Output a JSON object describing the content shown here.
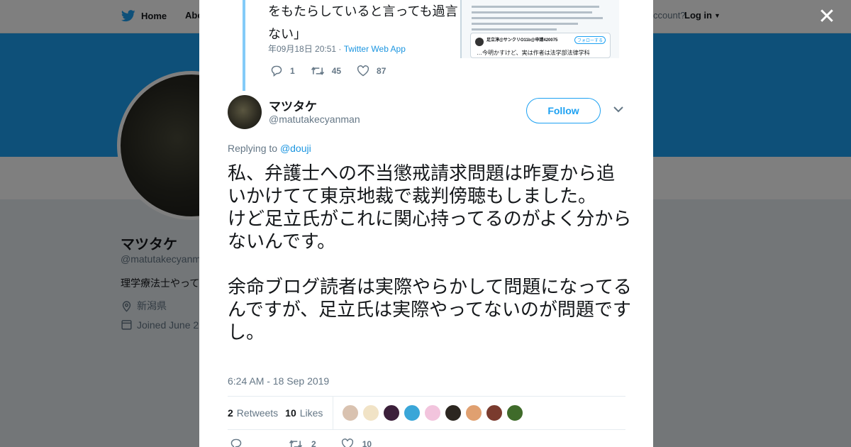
{
  "nav": {
    "home": "Home",
    "about": "Abo",
    "account_prompt": "ccount?",
    "login": "Log in"
  },
  "profile_bg": {
    "name": "マツタケ",
    "handle": "@matutakecyanm",
    "bio": "理学療法士やって",
    "location": "新潟県",
    "joined": "Joined June 2"
  },
  "quoted_tweet": {
    "text_line1": "をもたらしていると言っても過言",
    "text_line2": "ない」",
    "meta_date": "年09月18日 20:51 · ",
    "meta_app": "Twitter Web App",
    "reply_count": "1",
    "retweet_count": "45",
    "like_count": "87",
    "card_name": "足立淳@サンクリO11b@申請420075",
    "card_follow": "フォローする",
    "card_text": "…今明かすけど、実は作者は法学部法律学科"
  },
  "tweet": {
    "name": "マツタケ",
    "handle": "@matutakecyanman",
    "follow_label": "Follow",
    "replying_prefix": "Replying to ",
    "replying_to": "@douji",
    "text": "私、弁護士への不当懲戒請求問題は昨夏から追いかけてて東京地裁で裁判傍聴もしました。\nけど足立氏がこれに関心持ってるのがよく分からないんです。\n\n余命ブログ読者は実際やらかして問題になってるんですが、足立氏は実際やってないのが問題ですし。",
    "timestamp": "6:24 AM - 18 Sep 2019",
    "retweets_count": "2",
    "retweets_label": "Retweets",
    "likes_count": "10",
    "likes_label": "Likes",
    "bottom_retweets": "2",
    "bottom_likes": "10"
  },
  "likers": [
    {
      "name": "liker-1",
      "color": "#d9c2b0"
    },
    {
      "name": "liker-2",
      "color": "#f1e3c6"
    },
    {
      "name": "liker-3",
      "color": "#3b1f3a"
    },
    {
      "name": "liker-4",
      "color": "#3aa6d8"
    },
    {
      "name": "liker-5",
      "color": "#f2c4dd"
    },
    {
      "name": "liker-6",
      "color": "#2b2620"
    },
    {
      "name": "liker-7",
      "color": "#e0a070"
    },
    {
      "name": "liker-8",
      "color": "#7a3b2e"
    },
    {
      "name": "liker-9",
      "color": "#3f6b2a"
    }
  ],
  "colors": {
    "accent": "#1da1f2",
    "link": "#1b95e0",
    "text": "#14171a",
    "muted": "#657786"
  }
}
